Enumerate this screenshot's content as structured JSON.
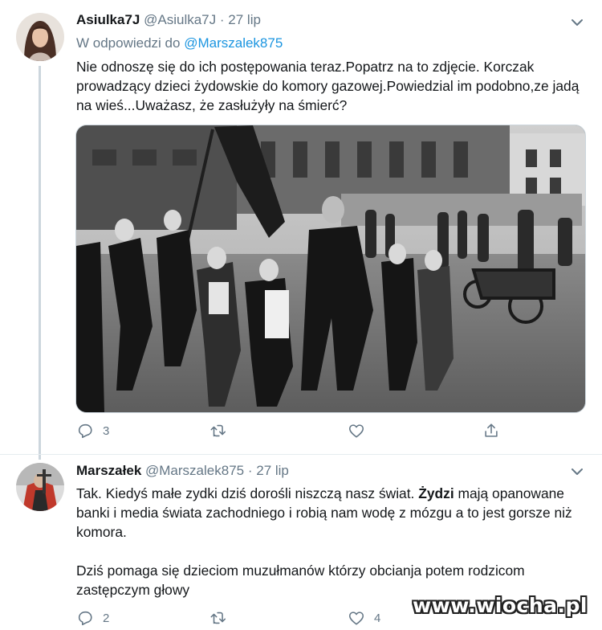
{
  "tweet1": {
    "display_name": "Asiulka7J",
    "handle": "@Asiulka7J",
    "separator": "·",
    "date": "27 lip",
    "reply_prefix": "W odpowiedzi do",
    "reply_to": "@Marszalek875",
    "text": "Nie odnoszę się do ich postępowania teraz.Popatrz na to zdjęcie. Korczak prowadzący dzieci żydowskie do komory gazowej.Powiedzial im podobno,ze jadą na wieś...Uważasz, że zasłużyły na śmierć?",
    "reply_count": "3",
    "retweet_count": "",
    "like_count": ""
  },
  "tweet2": {
    "display_name": "Marszałek",
    "handle": "@Marszalek875",
    "separator": "·",
    "date": "27 lip",
    "text_part1": "Tak. Kiedyś małe zydki dziś dorośli niszczą nasz świat. ",
    "text_bold": "Żydzi",
    "text_part2": " mają opanowane banki i media świata zachodniego i robią nam wodę z mózgu a to jest gorsze niż komora.",
    "text_para2": "Dziś pomaga się dzieciom muzułmanów którzy obcianja potem rodzicom zastępczym głowy",
    "reply_count": "2",
    "retweet_count": "",
    "like_count": "4"
  },
  "watermark": "www.wiocha.pl",
  "icons": {
    "reply": "reply-icon",
    "retweet": "retweet-icon",
    "like": "heart-icon",
    "share": "share-icon",
    "menu": "chevron-down-icon"
  },
  "colors": {
    "link": "#1b95e0",
    "muted": "#657786",
    "thread_line": "#ccd6dd"
  }
}
